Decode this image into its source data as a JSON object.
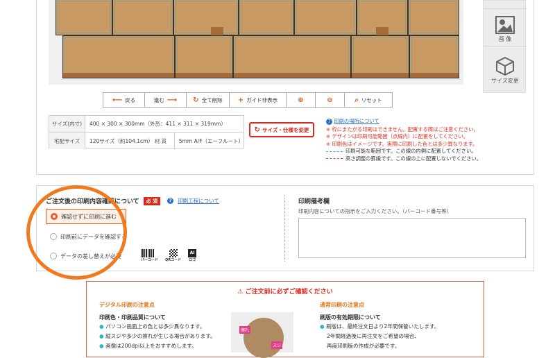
{
  "side": {
    "image_label": "画 像",
    "size_label": "サイズ変更"
  },
  "toolbar": {
    "back": "戻る",
    "forward": "進む",
    "delete_all": "全て削除",
    "guide": "ガイド非表示",
    "reset": "リセット"
  },
  "spec": {
    "size_label": "サイズ(内寸)",
    "size_value": "400 × 300 × 300mm（外形：411 × 311 × 319mm）",
    "delivery_label": "宅配サイズ",
    "delivery_value": "120サイズ（約104.1cm）",
    "material_label": "材 質",
    "material_value": "5mm A/F（エーフルート）"
  },
  "change_button": "サイズ・仕様を変更",
  "notes": {
    "link": "印刷の場所について",
    "items": [
      "※ 枠にまたがる印刷はできません。配置する際はご注意ください。",
      "※ デザインは印刷可能範囲（点線内）に配置をしてください。",
      "※ 印刷色はイメージです。実際に印刷した色とは多少異なります。"
    ],
    "legend1": "印刷可能な範囲です。この線の内側に配置してください。",
    "legend2": "高さ調整の罫線です。この線の上に配置しないでください。"
  },
  "confirm": {
    "title": "ご注文後の印刷内容確認について",
    "required": "必 須",
    "link": "印刷工程について",
    "options": [
      "確認せずに印刷に進む",
      "印刷前にデータを確認する",
      "データの差し替えが必要"
    ],
    "icons": [
      "バーコード",
      "QRコード",
      "ロゴ"
    ],
    "ai": "AI"
  },
  "memo": {
    "title": "印刷備考欄",
    "desc": "印刷内容についての指示をご入力ください。（バーコード番号等）"
  },
  "notice": {
    "header": "ご注文前に必ずご確認ください",
    "left_title": "デジタル印刷の注意点",
    "left_sub": "印刷色・印刷品質について",
    "left_items": [
      "パソコン画面上の色とは多少異なります。",
      "縦スジや多少の擦れが生じる場合があります。",
      "画像は200dpi以上をおすすめします。"
    ],
    "img_label1": "擦れ",
    "img_label2": "スジ",
    "right_title": "通常印刷の注意点",
    "right_sub": "刷版の有効期限について",
    "right_items": [
      "刷版は、最終注文日より2年間保管いたします。",
      "2年間経過後に再注文をご希望の場合、",
      "再度印刷版の作成が必要です。"
    ]
  },
  "colors": {
    "accent": "#f05a20",
    "red": "#d9291c",
    "cardboard": "#c99a63"
  }
}
